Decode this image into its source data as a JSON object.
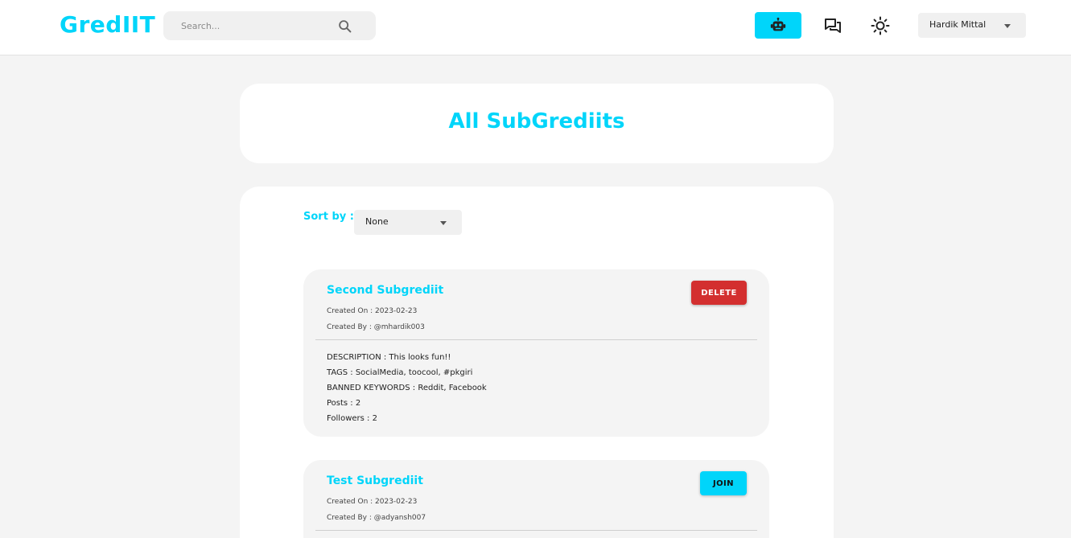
{
  "header": {
    "logo": "GredIIT",
    "search": {
      "placeholder": "Search...",
      "value": ""
    },
    "icons": [
      "robot-icon",
      "chat-icon",
      "sun-icon"
    ],
    "user_menu": {
      "selected": "Hardik Mittal"
    }
  },
  "title": "All SubGrediits",
  "sort": {
    "label": "Sort by :",
    "selected": "None"
  },
  "subgrediits": [
    {
      "name": "Second Subgrediit",
      "created_on": "Created On : 2023-02-23",
      "created_by": "Created By : @mhardik003",
      "action": "DELETE",
      "description": "DESCRIPTION : This looks fun!!",
      "tags": "TAGS : SocialMedia, toocool, #pkgiri",
      "banned": "BANNED KEYWORDS : Reddit, Facebook",
      "posts": "Posts : 2",
      "followers": "Followers : 2"
    },
    {
      "name": "Test Subgrediit",
      "created_on": "Created On : 2023-02-23",
      "created_by": "Created By : @adyansh007",
      "action": "JOIN"
    }
  ],
  "colors": {
    "accent": "#00d5fa",
    "danger": "#d32f2f",
    "background": "#f4f4f4",
    "card": "#ffffff"
  }
}
